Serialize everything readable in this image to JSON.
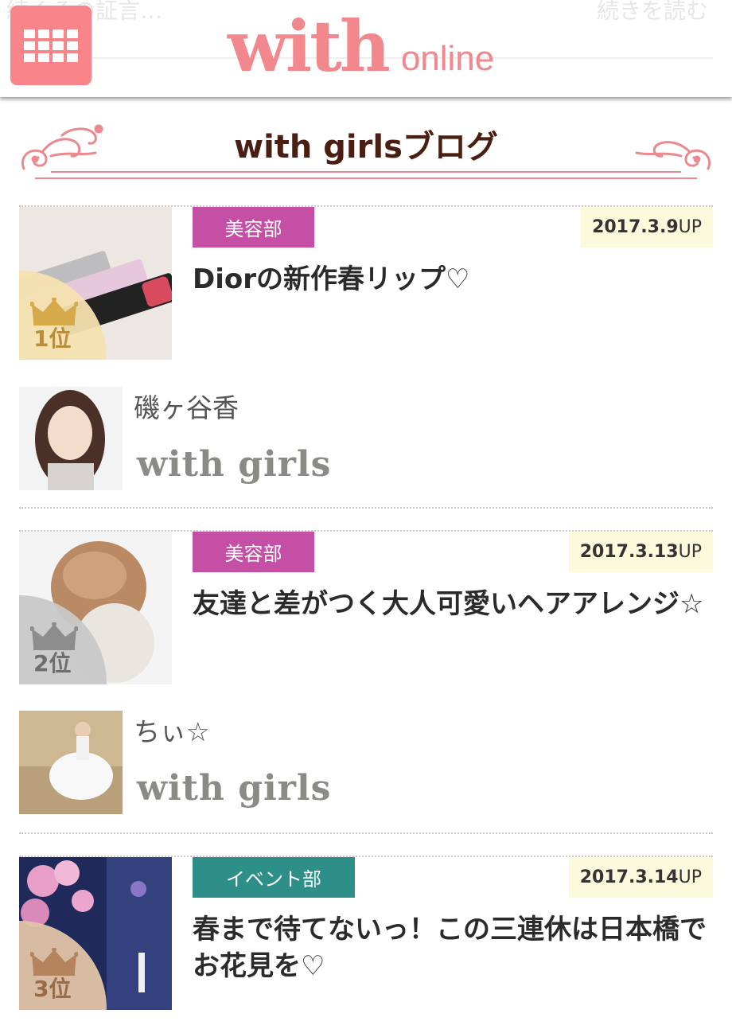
{
  "header": {
    "ghost_left": "続くその証言…",
    "ghost_right": "続きを読む",
    "logo_main": "with",
    "logo_sub": "online",
    "menu_icon": "grid-menu-icon",
    "accent_color": "#f9858a"
  },
  "section": {
    "title": "with girlsブログ"
  },
  "posts": [
    {
      "rank": "1位",
      "category": "美容部",
      "date_num": "2017.3.9",
      "date_suffix": "UP",
      "title": "Diorの新作春リップ♡",
      "author": "磯ヶ谷香",
      "brand": "with girls"
    },
    {
      "rank": "2位",
      "category": "美容部",
      "date_num": "2017.3.13",
      "date_suffix": "UP",
      "title": "友達と差がつく大人可愛いヘアアレンジ☆",
      "author": "ちぃ☆",
      "brand": "with girls"
    },
    {
      "rank": "3位",
      "category": "イベント部",
      "date_num": "2017.3.14",
      "date_suffix": "UP",
      "title": "春まで待てないっ！この三連休は日本橋でお花見を♡"
    }
  ],
  "colors": {
    "beauty_category": "#c64fa6",
    "event_category": "#2e8f89",
    "date_bg": "#fbfadc",
    "title_brown": "#4a1e10"
  }
}
